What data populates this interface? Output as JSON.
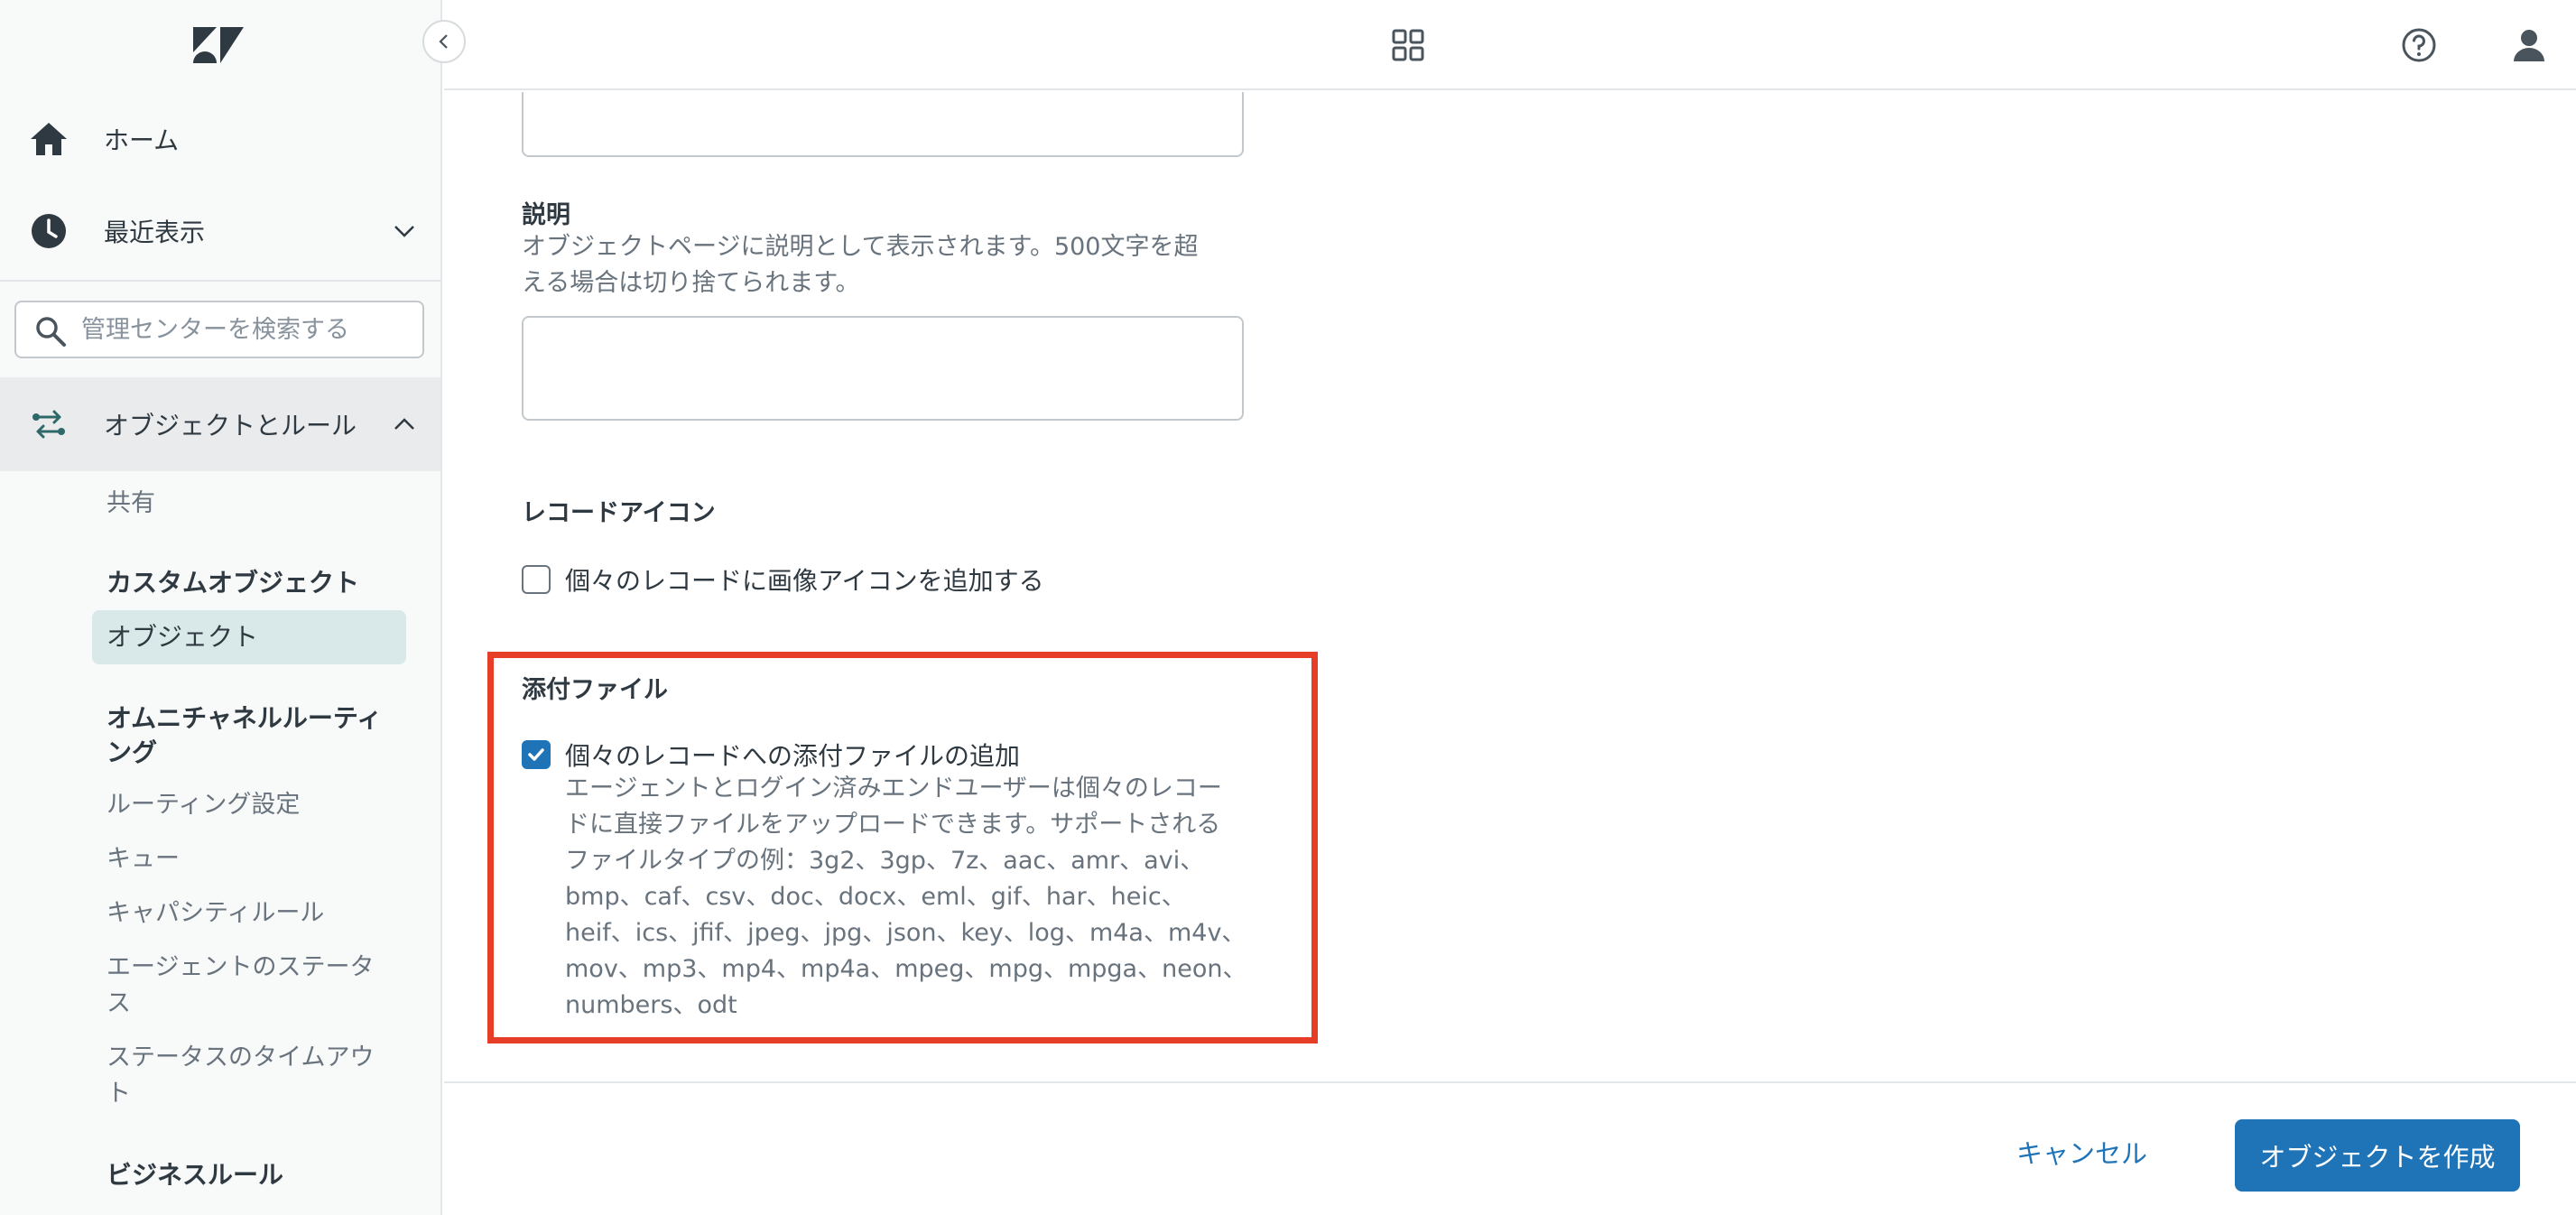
{
  "sidebar": {
    "collapse_icon": "chevron-left-icon",
    "nav": {
      "home": "ホーム",
      "recent": "最近表示",
      "objects_rules": "オブジェクトとルール"
    },
    "search": {
      "placeholder": "管理センターを検索する"
    },
    "sub": {
      "shared": "共有",
      "custom_objects_heading": "カスタムオブジェクト",
      "objects": "オブジェクト",
      "omni_heading_line1": "オムニチャネルルーティ",
      "omni_heading_line2": "ング",
      "routing_settings": "ルーティング設定",
      "queues": "キュー",
      "capacity_rules": "キャパシティルール",
      "agent_status_line1": "エージェントのステータ",
      "agent_status_line2": "ス",
      "status_timeout_line1": "ステータスのタイムアウ",
      "status_timeout_line2": "ト",
      "business_rules_heading": "ビジネスルール"
    }
  },
  "header": {
    "icons": [
      "apps-grid-icon",
      "help-icon",
      "user-icon"
    ]
  },
  "form": {
    "description": {
      "label": "説明",
      "hint_line1": "オブジェクトページに説明として表示されます。500文字を超",
      "hint_line2": "える場合は切り捨てられます。"
    },
    "record_icon": {
      "label": "レコードアイコン",
      "checkbox_label": "個々のレコードに画像アイコンを追加する",
      "checked": false
    },
    "attachments": {
      "label": "添付ファイル",
      "checkbox_label": "個々のレコードへの添付ファイルの追加",
      "checked": true,
      "desc_lines": [
        "エージェントとログイン済みエンドユーザーは個々のレコー",
        "ドに直接ファイルをアップロードできます。サポートされる",
        "ファイルタイプの例：3g2、3gp、7z、aac、amr、avi、",
        "bmp、caf、csv、doc、docx、eml、gif、har、heic、",
        "heif、ics、jfif、jpeg、jpg、json、key、log、m4a、m4v、",
        "mov、mp3、mp4、mp4a、mpeg、mpg、mpga、neon、",
        "numbers、odt"
      ]
    }
  },
  "footer": {
    "cancel_label": "キャンセル",
    "create_label": "オブジェクトを作成"
  },
  "colors": {
    "accent": "#1f73b7",
    "highlight_border": "#e53d27",
    "sidebar_active": "#d9e8e8"
  }
}
